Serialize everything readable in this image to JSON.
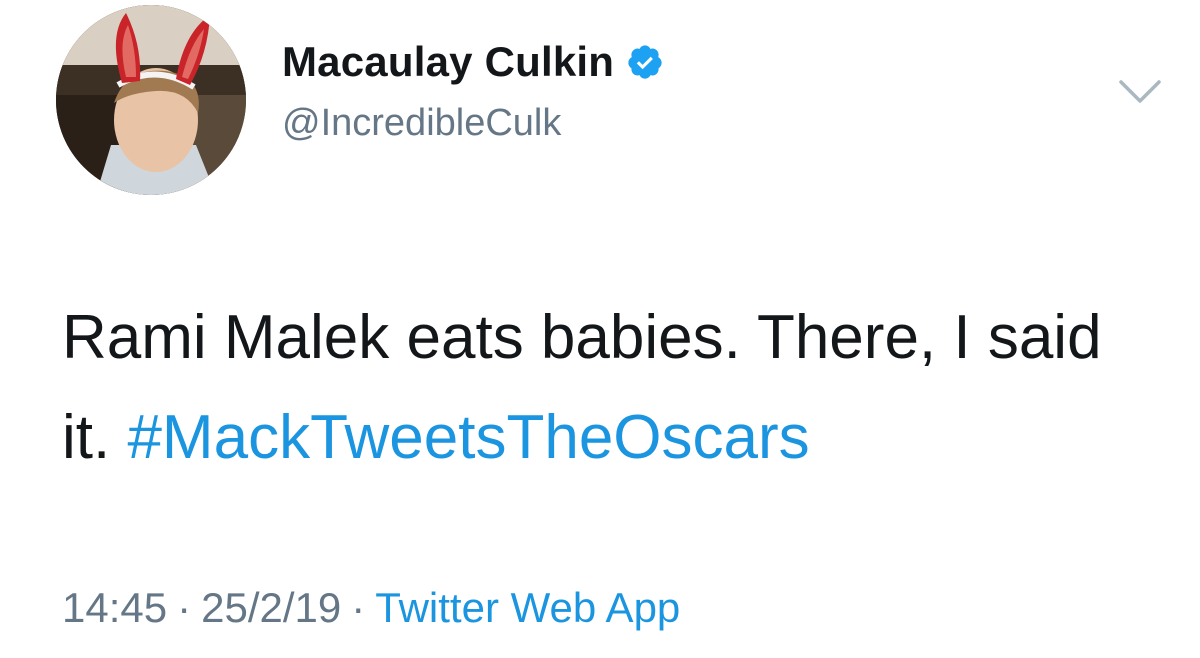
{
  "user": {
    "display_name": "Macaulay Culkin",
    "handle": "@IncredibleCulk",
    "verified_icon": "verified-badge-icon",
    "avatar_icon": "avatar-bunny-ears"
  },
  "menu": {
    "icon": "chevron-down-icon"
  },
  "tweet": {
    "text": "Rami Malek eats babies. There, I said it. ",
    "hashtag": "#MackTweetsTheOscars"
  },
  "meta": {
    "time": "14:45",
    "separator": "·",
    "date": "25/2/19",
    "source": "Twitter Web App"
  },
  "colors": {
    "link": "#1b95e0",
    "secondary_text": "#657786",
    "primary_text": "#14171a",
    "verified": "#1da1f2"
  }
}
